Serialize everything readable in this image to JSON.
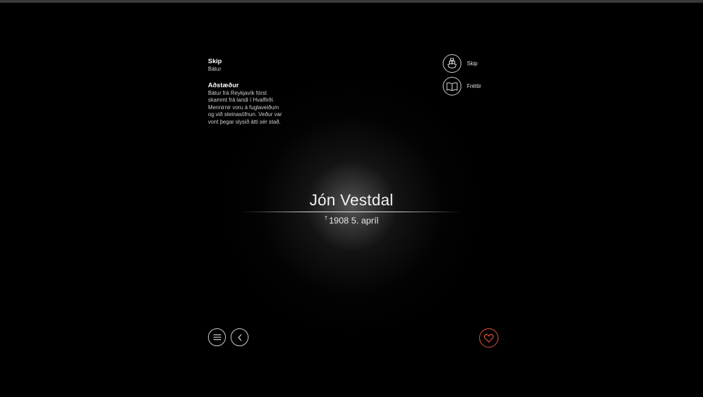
{
  "info": {
    "ship_heading": "Skip",
    "ship_value": "Bátur",
    "circumstances_heading": "Aðstæður",
    "circumstances_text": "Bátur frá Reykjavík fórst skammt frá landi í Hvalfirði. Mennirnir voru á fuglaveiðum og við steinasöfnun. Veður var vont þegar slysið átti sér stað."
  },
  "side_links": [
    {
      "label": "Skip",
      "icon": "ship-icon"
    },
    {
      "label": "Fréttir",
      "icon": "book-icon"
    }
  ],
  "person": {
    "name": "Jón Vestdal",
    "death_symbol": "†",
    "death_date": "1908 5. apríl"
  },
  "bottom_nav": {
    "menu_icon": "menu-icon",
    "back_icon": "chevron-left-icon",
    "favorite_icon": "heart-icon"
  },
  "colors": {
    "background": "#000000",
    "text": "#f2f2f2",
    "accent": "#e0553a"
  }
}
